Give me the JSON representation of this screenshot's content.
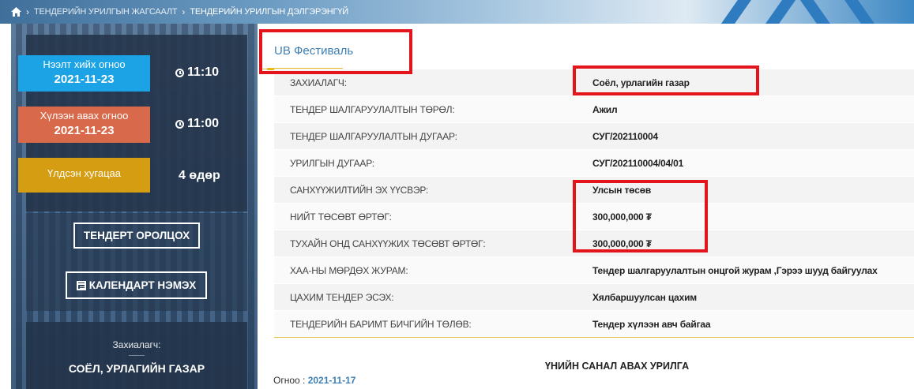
{
  "breadcrumb": {
    "home_icon": "home-icon",
    "items": [
      "ТЕНДЕРИЙН УРИЛГЫН ЖАГСААЛТ",
      "ТЕНДЕРИЙН УРИЛГЫН ДЭЛГЭРЭНГҮЙ"
    ]
  },
  "left": {
    "open_label": "Нээлт хийх огноо",
    "open_date": "2021-11-23",
    "open_time": "11:10",
    "receive_label": "Хүлээн авах огноо",
    "receive_date": "2021-11-23",
    "receive_time": "11:00",
    "duration_label": "Үлдсэн хугацаа",
    "duration_value": "4 өдөр",
    "join_button": "ТЕНДЕРТ ОРОЛЦОХ",
    "calendar_button": "КАЛЕНДАРТ НЭМЭХ",
    "customer_label": "Захиалагч:",
    "customer_value": "СОЁЛ, УРЛАГИЙН ГАЗАР"
  },
  "main": {
    "title": "UB Фестиваль",
    "rows": [
      {
        "key": "ЗАХИАЛАГЧ:",
        "value": "Соёл, урлагийн газар"
      },
      {
        "key": "ТЕНДЕР ШАЛГАРУУЛАЛТЫН ТӨРӨЛ:",
        "value": "Ажил"
      },
      {
        "key": "ТЕНДЕР ШАЛГАРУУЛАЛТЫН ДУГААР:",
        "value": "СУГ/202110004"
      },
      {
        "key": "УРИЛГЫН ДУГААР:",
        "value": "СУГ/202110004/04/01"
      },
      {
        "key": "САНХҮҮЖИЛТИЙН ЭХ ҮҮСВЭР:",
        "value": "Улсын төсөв"
      },
      {
        "key": "НИЙТ ТӨСӨВТ ӨРТӨГ:",
        "value": "300,000,000 ₮"
      },
      {
        "key": "ТУХАЙН ОНД САНХҮҮЖИХ ТӨСӨВТ ӨРТӨГ:",
        "value": "300,000,000 ₮"
      },
      {
        "key": "ХАА-НЫ МӨРДӨХ ЖУРАМ:",
        "value": "Тендер шалгаруулалтын онцгой журам ,Гэрээ шууд байгуулах"
      },
      {
        "key": "ЦАХИМ ТЕНДЕР ЭСЭХ:",
        "value": "Хялбаршуулсан цахим"
      },
      {
        "key": "ТЕНДЕРИЙН БАРИМТ БИЧГИЙН ТӨЛӨВ:",
        "value": "Тендер хүлээн авч байгаа"
      }
    ],
    "section_heading": "ҮНИЙН САНАЛ АВАХ УРИЛГА",
    "date_label": "Огноо :",
    "date_value": "2021-11-17"
  },
  "colors": {
    "accent_blue": "#3d7fb5",
    "open_box": "#1ba3e6",
    "receive_box": "#d8694a",
    "duration_box": "#d59e12",
    "highlight": "#e3141c",
    "gold_line": "#e2c04a"
  }
}
